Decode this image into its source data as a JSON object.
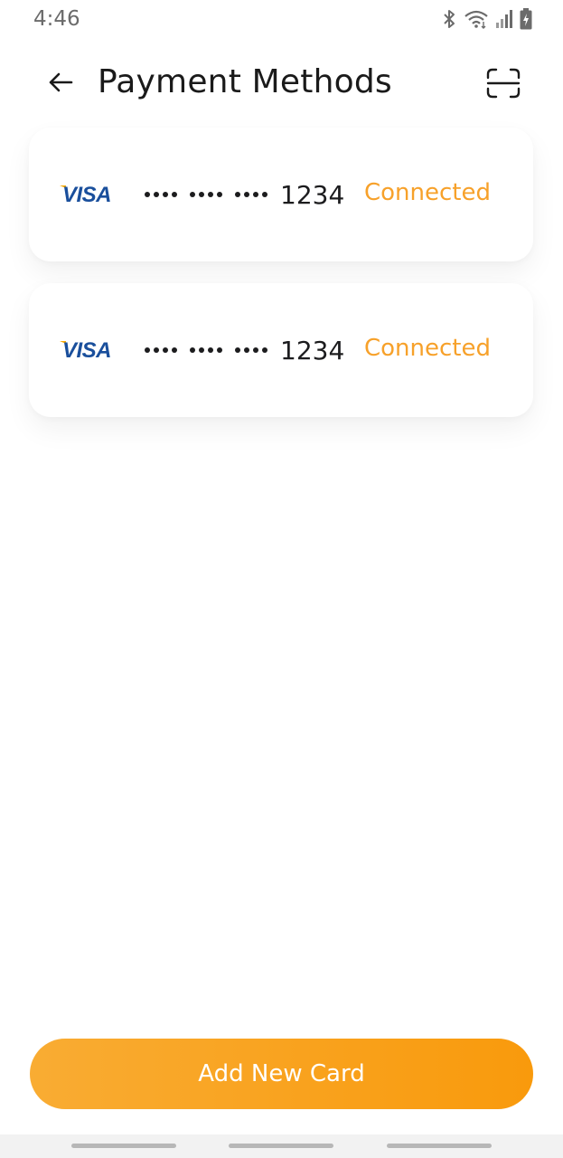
{
  "status_bar": {
    "time": "4:46",
    "icons": [
      "bluetooth-icon",
      "wifi-icon",
      "signal-icon",
      "battery-charging-icon"
    ]
  },
  "header": {
    "title": "Payment Methods",
    "back_icon": "arrow-left-icon",
    "scan_icon": "scan-frame-icon"
  },
  "cards": [
    {
      "brand": "VISA",
      "masked": "•••• •••• ••••",
      "last4": "1234",
      "status": "Connected"
    },
    {
      "brand": "VISA",
      "masked": "•••• •••• ••••",
      "last4": "1234",
      "status": "Connected"
    }
  ],
  "add_button": {
    "label": "Add New Card"
  },
  "colors": {
    "accent": "#f99a0c",
    "status_text": "#f7a12a",
    "visa_blue": "#1a4f9c",
    "visa_gold": "#f7a800",
    "background": "#ffffff"
  }
}
